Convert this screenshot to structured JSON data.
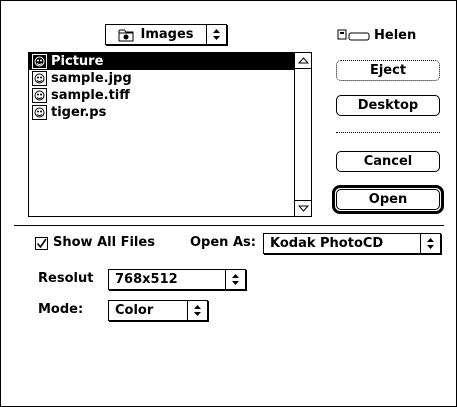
{
  "folder_popup": {
    "label": "Images",
    "icon": "folder-icon",
    "arrow": "up-down-arrows-icon"
  },
  "volume": {
    "name": "Helen",
    "icon": "disk-drive-icon"
  },
  "files": [
    {
      "name": "Picture",
      "selected": true,
      "icon": "picture-file-icon"
    },
    {
      "name": "sample.jpg",
      "selected": false,
      "icon": "picture-file-icon"
    },
    {
      "name": "sample.tiff",
      "selected": false,
      "icon": "picture-file-icon"
    },
    {
      "name": "tiger.ps",
      "selected": false,
      "icon": "picture-file-icon"
    }
  ],
  "buttons": {
    "eject": "Eject",
    "desktop": "Desktop",
    "cancel": "Cancel",
    "open": "Open"
  },
  "show_all_files": {
    "label": "Show All Files",
    "checked": true
  },
  "open_as": {
    "label": "Open As:",
    "value": "Kodak PhotoCD"
  },
  "resolution": {
    "label": "Resolut",
    "value": "768x512"
  },
  "mode": {
    "label": "Mode:",
    "value": "Color"
  }
}
